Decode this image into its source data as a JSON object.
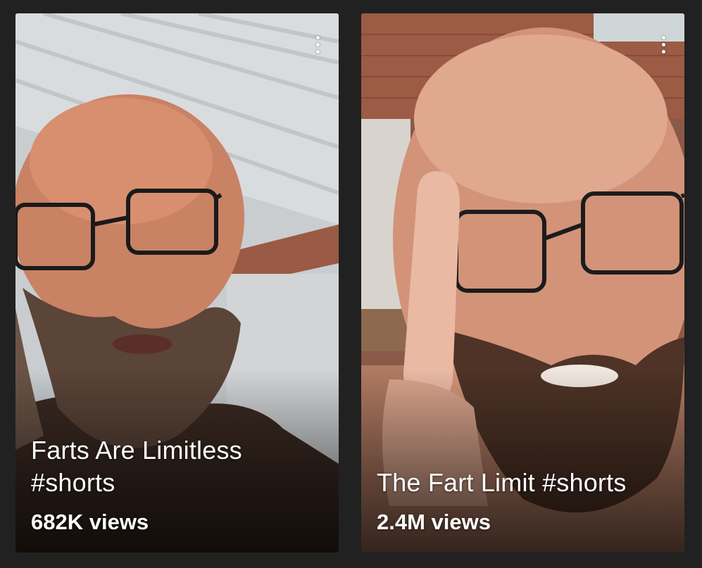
{
  "shorts": [
    {
      "title": "Farts Are Limitless #shorts",
      "title_line_1": "Farts Are Limitless",
      "title_line_2": "#shorts",
      "views": "682K views",
      "menu_icon": "more-vert-icon"
    },
    {
      "title": "The Fart Limit #shorts",
      "views": "2.4M views",
      "menu_icon": "more-vert-icon"
    }
  ],
  "colors": {
    "background": "#212121",
    "text": "#ffffff"
  }
}
